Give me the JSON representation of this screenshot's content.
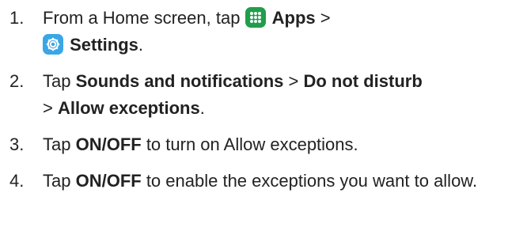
{
  "steps": [
    {
      "number": "1.",
      "text1": "From a Home screen, tap ",
      "apps": "Apps",
      "sep": " >",
      "settings": "Settings",
      "end": "."
    },
    {
      "number": "2.",
      "text1": "Tap ",
      "sounds": "Sounds and notifications",
      "sep1": " > ",
      "dnd": "Do not disturb",
      "sep2": "> ",
      "allow": "Allow exceptions",
      "end": "."
    },
    {
      "number": "3.",
      "text1": "Tap ",
      "onoff": "ON/OFF",
      "text2": " to turn on Allow exceptions."
    },
    {
      "number": "4.",
      "text1": "Tap ",
      "onoff": "ON/OFF",
      "text2": " to enable the exceptions you want to allow."
    }
  ],
  "icons": {
    "apps": "apps-grid-icon",
    "settings": "settings-gear-icon",
    "apps_color": "#1f9e4b",
    "settings_color": "#3aa6e6"
  }
}
